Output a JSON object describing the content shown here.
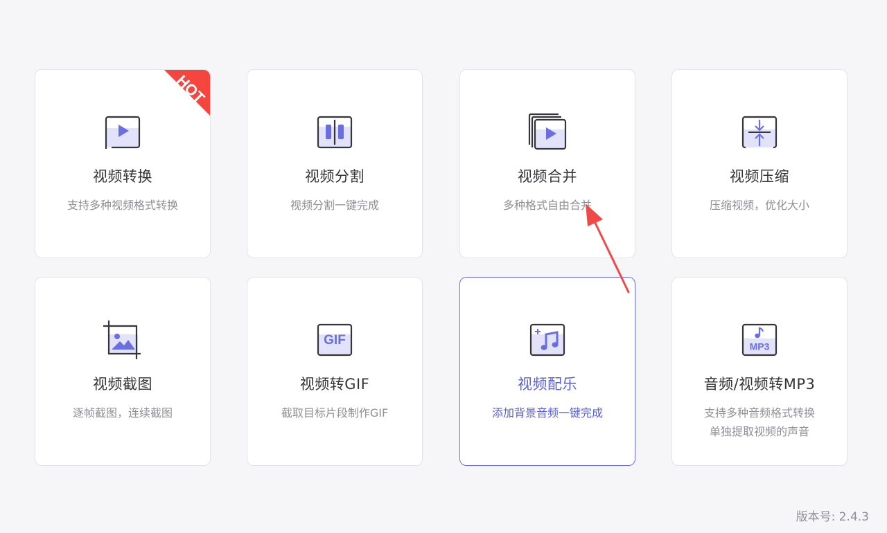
{
  "cards": [
    {
      "title": "视频转换",
      "desc1": "支持多种视频格式转换",
      "desc2": ""
    },
    {
      "title": "视频分割",
      "desc1": "视频分割一键完成",
      "desc2": ""
    },
    {
      "title": "视频合并",
      "desc1": "多种格式自由合并",
      "desc2": ""
    },
    {
      "title": "视频压缩",
      "desc1": "压缩视频，优化大小",
      "desc2": ""
    },
    {
      "title": "视频截图",
      "desc1": "逐帧截图，连续截图",
      "desc2": ""
    },
    {
      "title": "视频转GIF",
      "desc1": "截取目标片段制作GIF",
      "desc2": ""
    },
    {
      "title": "视频配乐",
      "desc1": "添加背景音频一键完成",
      "desc2": ""
    },
    {
      "title": "音频/视频转MP3",
      "desc1": "支持多种音频格式转换",
      "desc2": "单独提取视频的声音"
    }
  ],
  "hot_badge": "HOT",
  "icon_texts": {
    "gif": "GIF",
    "mp3": "MP3"
  },
  "version": "版本号: 2.4.3",
  "colors": {
    "accent": "#6a6ee0",
    "hot": "#f5453f",
    "icon_stroke": "#34343a",
    "icon_fill": "#6a6ee0",
    "icon_bg": "#e2e3fa"
  }
}
